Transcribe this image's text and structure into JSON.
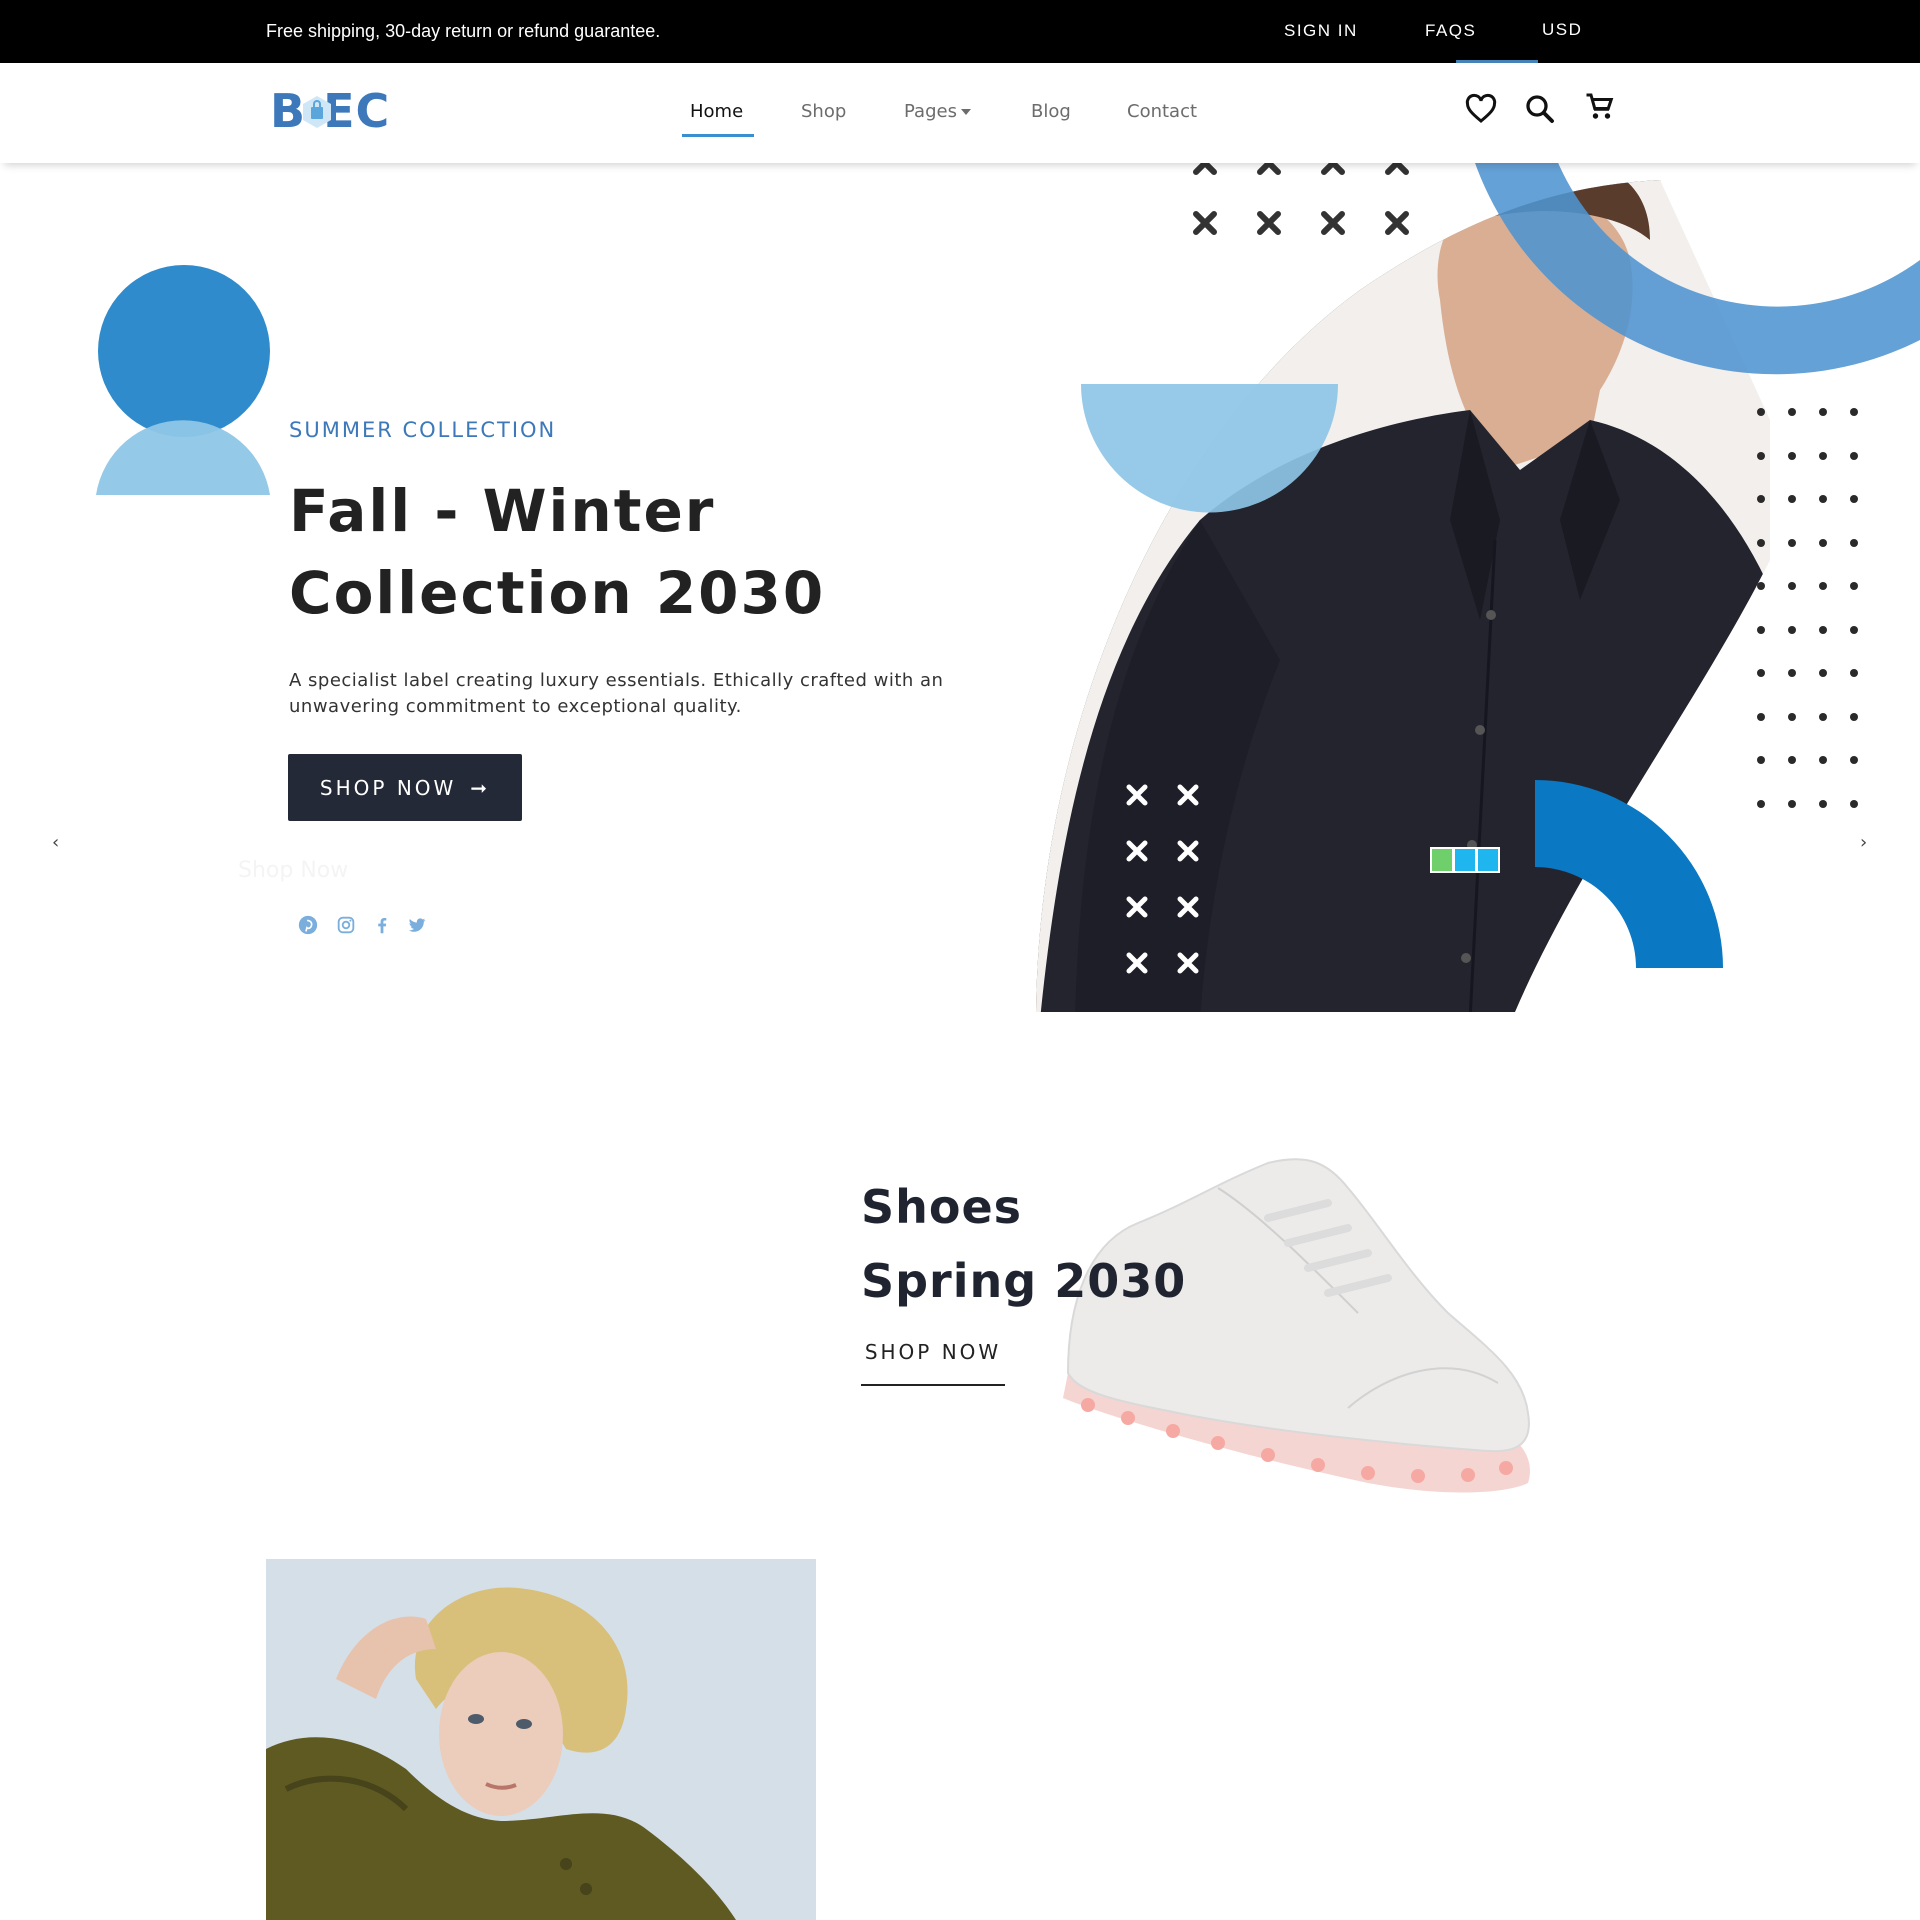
{
  "topbar": {
    "promo": "Free shipping, 30-day return or refund guarantee.",
    "sign_in": "SIGN IN",
    "faqs": "FAQS",
    "currency": "USD"
  },
  "nav": {
    "logo_text": "B EC",
    "items": [
      {
        "label": "Home",
        "active": true
      },
      {
        "label": "Shop"
      },
      {
        "label": "Pages",
        "has_dropdown": true
      },
      {
        "label": "Blog"
      },
      {
        "label": "Contact"
      }
    ],
    "icons": [
      "heart-icon",
      "search-icon",
      "cart-icon"
    ]
  },
  "hero": {
    "subtitle": "SUMMER COLLECTION",
    "title_line1": "Fall - Winter",
    "title_line2": "Collection 2030",
    "description": "A specialist label creating luxury essentials. Ethically crafted with an unwavering commitment to exceptional quality.",
    "button": "SHOP NOW",
    "ghost_link": "Shop Now",
    "social": [
      "pinterest-icon",
      "instagram-icon",
      "facebook-icon",
      "twitter-icon"
    ],
    "prev": "‹",
    "next": "›"
  },
  "promo": {
    "title_line1": "Shoes",
    "title_line2": "Spring 2030",
    "link": "SHOP NOW"
  },
  "colors": {
    "accent": "#3d78ba",
    "dark": "#232936",
    "light_blue": "#8ec6e6",
    "mid_blue": "#4f94d0",
    "deep_blue": "#0a78c2"
  }
}
